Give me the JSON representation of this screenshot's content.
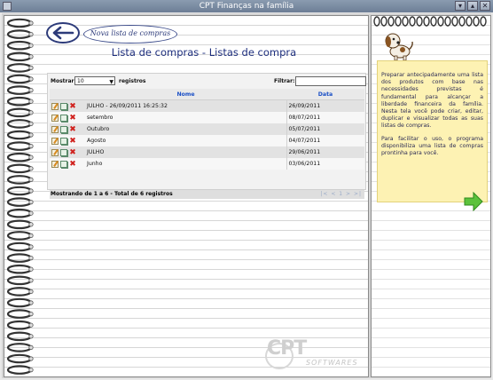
{
  "window": {
    "title": "CPT Finanças na família",
    "controls": [
      "▾",
      "▴",
      "✕"
    ]
  },
  "toolbar": {
    "nova_label": "Nova lista de compras"
  },
  "page": {
    "title": "Lista de compras - Listas de compra"
  },
  "list": {
    "show_label": "Mostrar",
    "show_value": "10",
    "show_suffix": "registros",
    "filter_label": "Filtrar:",
    "filter_value": "",
    "columns": {
      "name": "Nome",
      "date": "Data"
    },
    "rows": [
      {
        "name": "JULHO - 26/09/2011 16:25:32",
        "date": "26/09/2011"
      },
      {
        "name": "setembro",
        "date": "08/07/2011"
      },
      {
        "name": "Outubro",
        "date": "05/07/2011"
      },
      {
        "name": "Agosto",
        "date": "04/07/2011"
      },
      {
        "name": "JULHO",
        "date": "29/06/2011"
      },
      {
        "name": "Junho",
        "date": "03/06/2011"
      }
    ],
    "summary": "Mostrando de 1 a 6 - Total de 6 registros",
    "pager": "|< < 1 > >|"
  },
  "help": {
    "paragraph1": "Preparar antecipadamente uma lista dos produtos com base nas necessidades previstas é fundamental para alcançar a liberdade financeira da família. Nesta tela você pode criar, editar, duplicar e visualizar todas as suas listas de compras.",
    "paragraph2": "Para facilitar o uso, o programa disponibiliza uma lista de compras prontinha para você."
  },
  "logo": {
    "brand": "CPT",
    "subtitle": "SOFTWARES"
  },
  "colors": {
    "title_blue": "#1e2f7e",
    "header_blue": "#1a4fc6",
    "note_yellow": "#fdf2b3",
    "arrow_green": "#5cc23c"
  }
}
